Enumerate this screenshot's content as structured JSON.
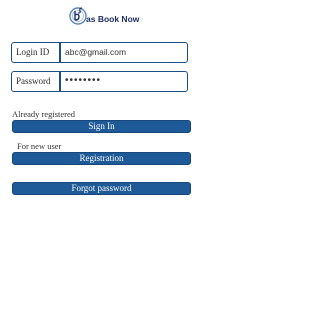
{
  "app": {
    "logo_text": "as Book Now"
  },
  "login": {
    "login_id_label": "Login ID",
    "login_id_value": "abc@gmail.com",
    "password_label": "Password",
    "password_value": "••••••••"
  },
  "existing": {
    "prompt": "Already registered",
    "button": "Sign In"
  },
  "new_user": {
    "prompt": "For new user",
    "button": "Registration"
  },
  "forgot": {
    "button": "Forgot password"
  },
  "colors": {
    "primary": "#1e5a97",
    "border": "#1c4f86"
  }
}
